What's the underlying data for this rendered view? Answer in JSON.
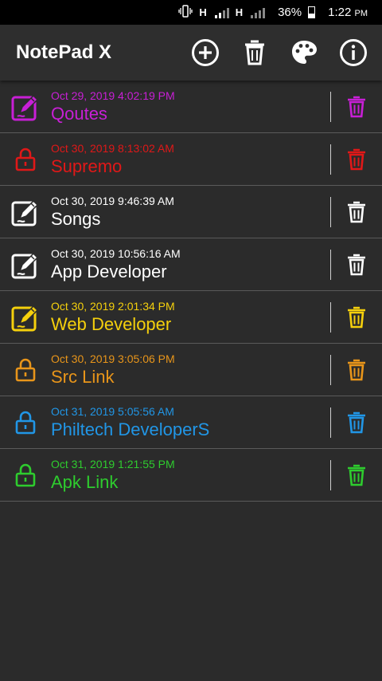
{
  "status_bar": {
    "network_1": "H",
    "network_2": "H",
    "battery": "36%",
    "time": "1:22",
    "time_suffix": "PM"
  },
  "app_bar": {
    "title": "NotePad X",
    "actions": [
      "add-icon",
      "delete-all-icon",
      "palette-icon",
      "info-icon"
    ]
  },
  "notes": [
    {
      "date": "Oct 29, 2019 4:02:19 PM",
      "title": "Qoutes",
      "color": "#c81fd6",
      "type": "note"
    },
    {
      "date": "Oct 30, 2019 8:13:02 AM",
      "title": "Supremo",
      "color": "#e01818",
      "type": "locked"
    },
    {
      "date": "Oct 30, 2019 9:46:39 AM",
      "title": "Songs",
      "color": "#ffffff",
      "type": "note"
    },
    {
      "date": "Oct 30, 2019 10:56:16 AM",
      "title": "App Developer",
      "color": "#ffffff",
      "type": "note"
    },
    {
      "date": "Oct 30, 2019 2:01:34 PM",
      "title": "Web Developer",
      "color": "#f5d00c",
      "type": "note"
    },
    {
      "date": "Oct 30, 2019 3:05:06 PM",
      "title": "Src Link",
      "color": "#e8951a",
      "type": "locked"
    },
    {
      "date": "Oct 31, 2019 5:05:56 AM",
      "title": "Philtech DeveloperS",
      "color": "#2196e6",
      "type": "locked"
    },
    {
      "date": "Oct 31, 2019 1:21:55 PM",
      "title": "Apk Link",
      "color": "#2ecc2e",
      "type": "locked"
    }
  ]
}
